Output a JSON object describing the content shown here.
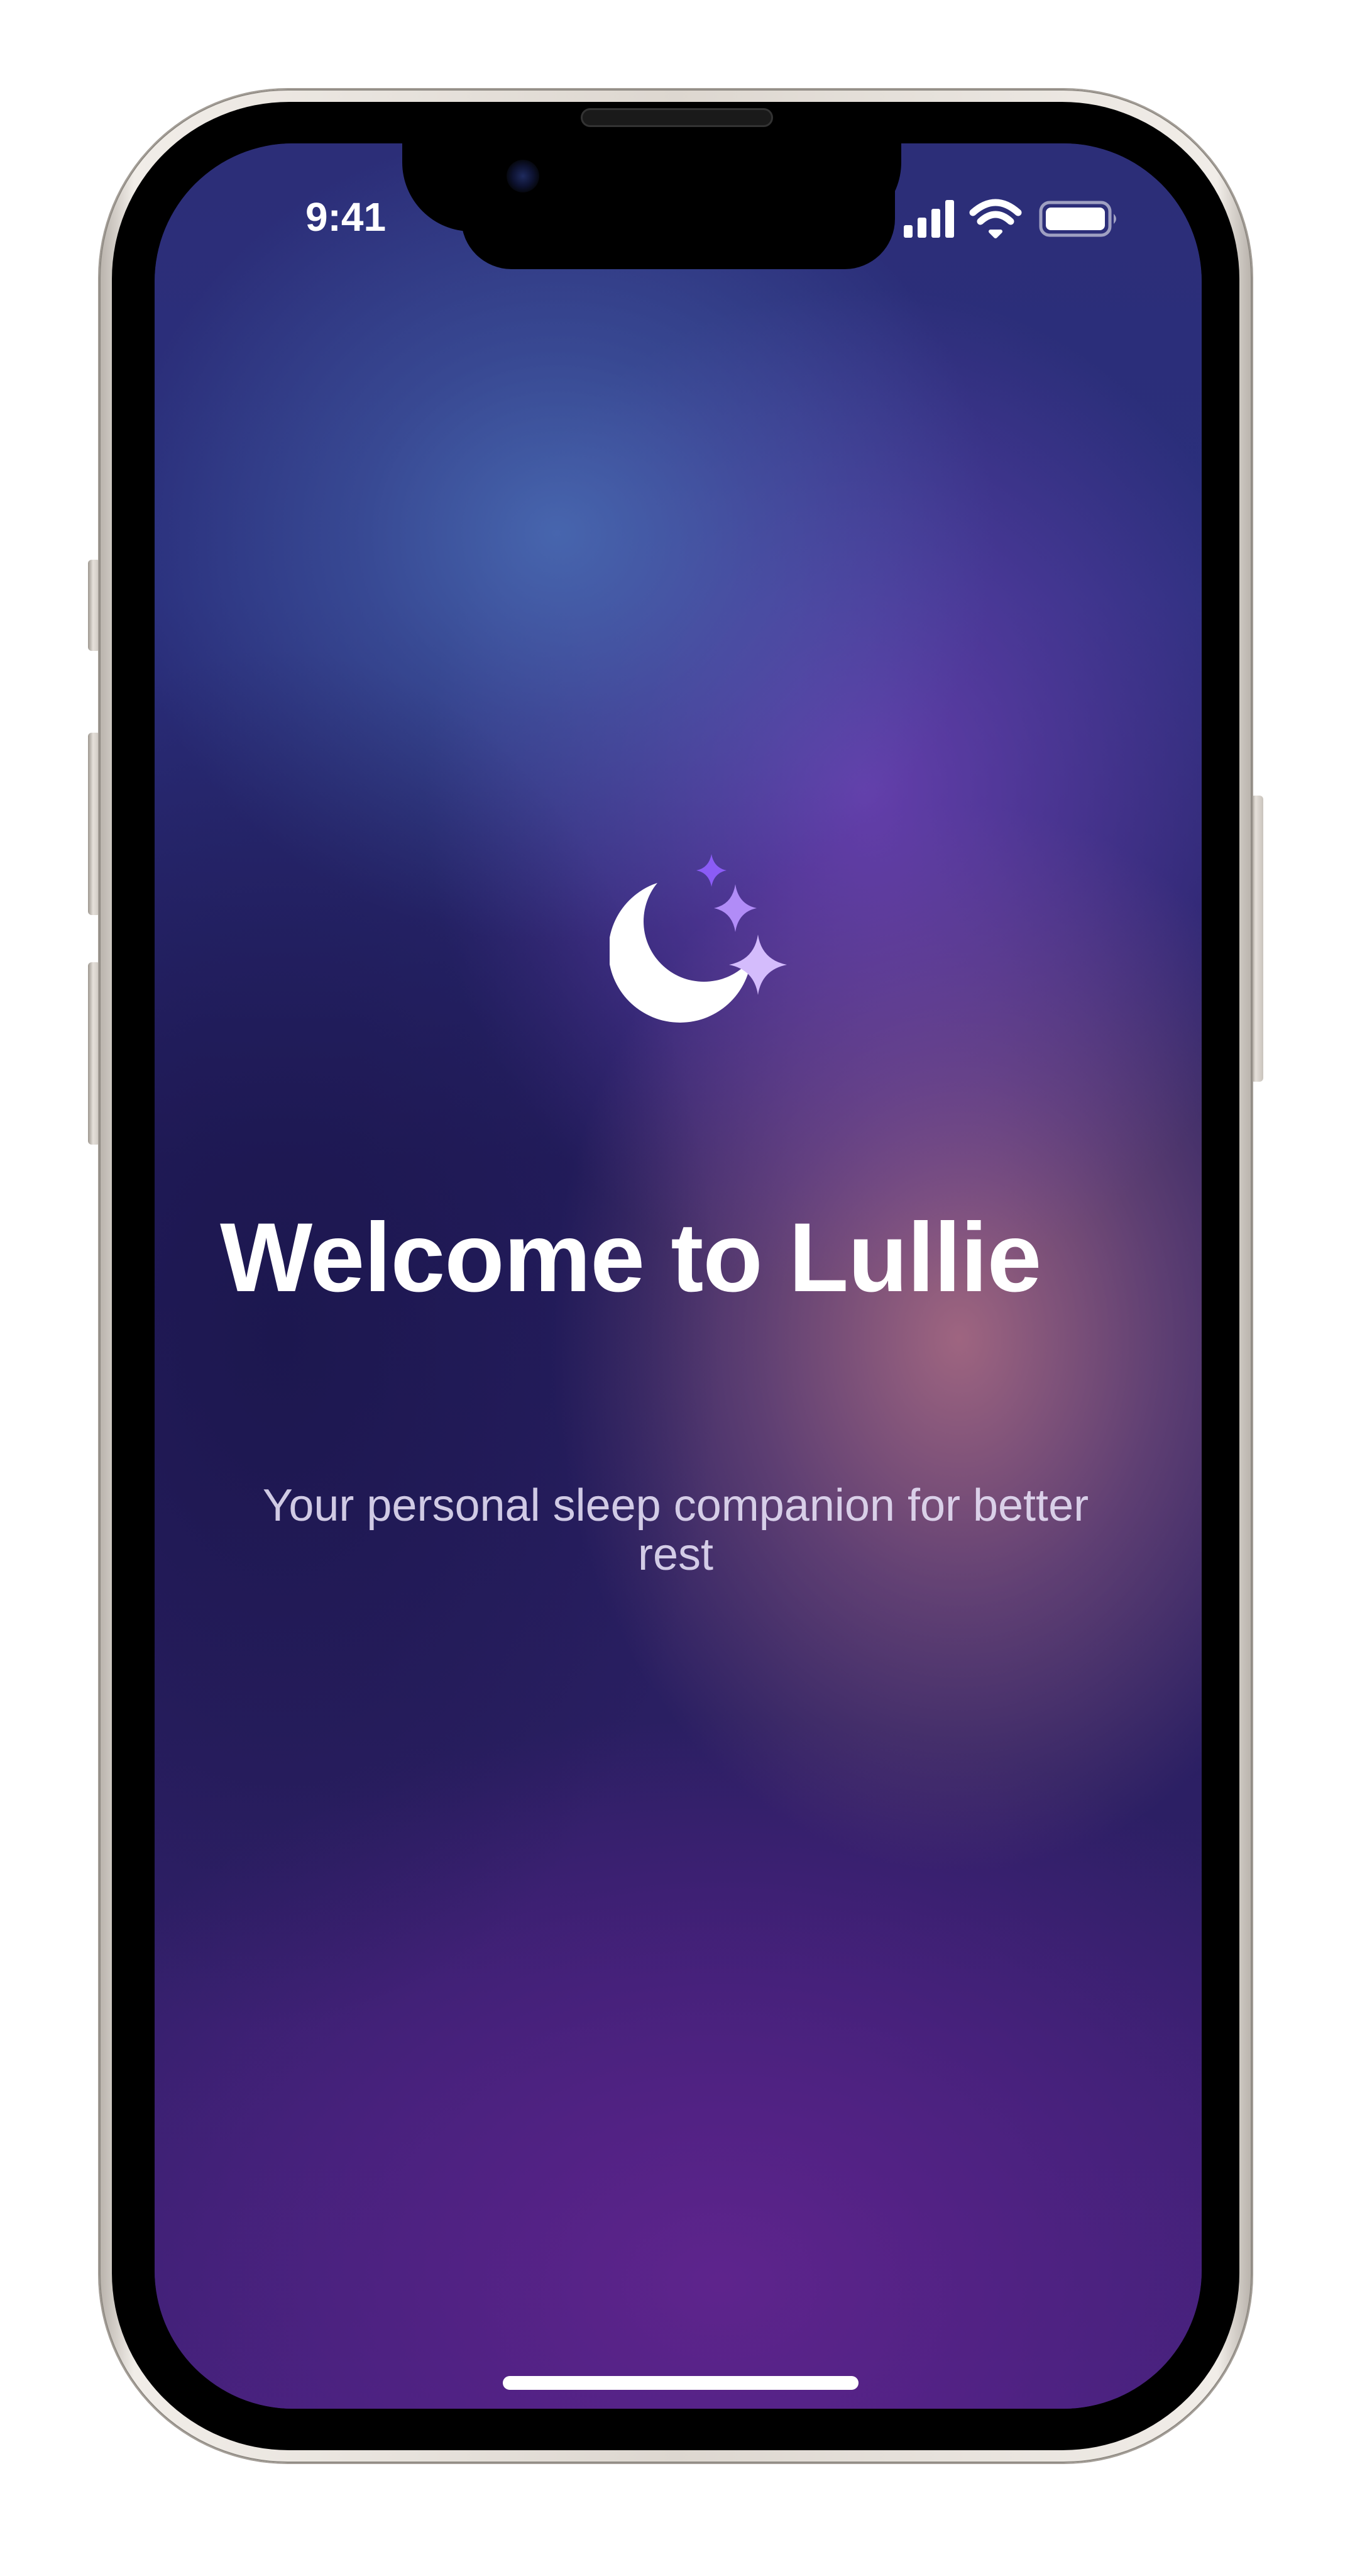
{
  "status_bar": {
    "time": "9:41",
    "icons": [
      "signal-icon",
      "wifi-icon",
      "battery-icon"
    ]
  },
  "logo": {
    "icon": "moon-stars-icon",
    "moon_color": "#ffffff",
    "star_colors": [
      "#8b5cf6",
      "#b18cf7",
      "#d4bcfc"
    ]
  },
  "welcome": {
    "title": "Welcome to Lullie",
    "subtitle": "Your personal sleep companion for better rest"
  },
  "colors": {
    "text": "#ffffff",
    "subtitle_text": "#e8e2f8",
    "accent": "#8b5cf6"
  }
}
